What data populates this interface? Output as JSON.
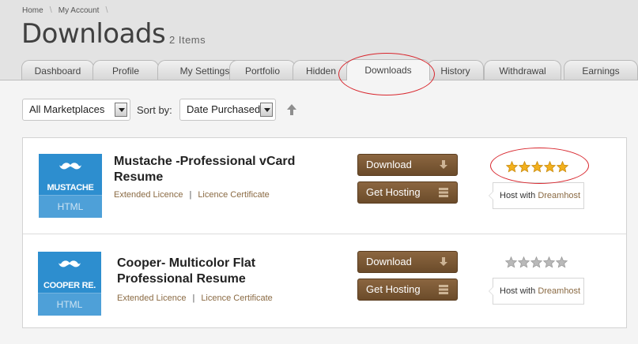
{
  "breadcrumb": {
    "home": "Home",
    "account": "My Account"
  },
  "header": {
    "title": "Downloads",
    "count": "2 Items"
  },
  "tabs": [
    {
      "label": "Dashboard"
    },
    {
      "label": "Profile"
    },
    {
      "label": "My Settings"
    },
    {
      "label": "Portfolio"
    },
    {
      "label": "Hidden"
    },
    {
      "label": "Downloads",
      "active": true
    },
    {
      "label": "History"
    },
    {
      "label": "Withdrawal"
    },
    {
      "label": "Earnings"
    }
  ],
  "filters": {
    "marketplace": "All Marketplaces",
    "sort_label": "Sort by:",
    "sort_value": "Date Purchased"
  },
  "items": [
    {
      "thumb_name": "MUSTACHE",
      "thumb_sub": "HTML",
      "title": "Mustache -Professional vCard Resume",
      "license": "Extended Licence",
      "certificate": "Licence Certificate",
      "download_label": "Download",
      "hosting_label": "Get Hosting",
      "rating": 5,
      "host_prefix": "Host with",
      "host_brand": "Dreamhost"
    },
    {
      "thumb_name": "COOPER RE.",
      "thumb_sub": "HTML",
      "title": "Cooper- Multicolor Flat Professional Resume",
      "license": "Extended Licence",
      "certificate": "Licence Certificate",
      "download_label": "Download",
      "hosting_label": "Get Hosting",
      "rating": 0,
      "host_prefix": "Host with",
      "host_brand": "Dreamhost"
    }
  ],
  "colors": {
    "accent_brown": "#7a5834",
    "star_gold": "#f2b01e",
    "star_empty": "#b9b9b9",
    "thumb_blue": "#2d8ecf",
    "annotation_red": "#d8262d"
  }
}
